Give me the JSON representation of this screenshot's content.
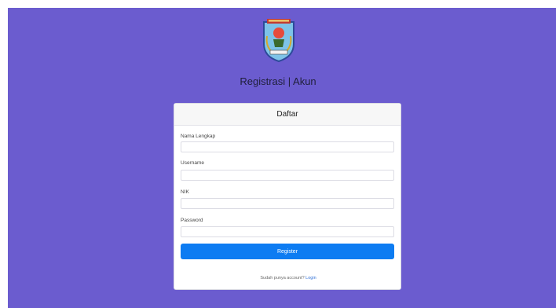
{
  "header": {
    "title": "Registrasi | Akun"
  },
  "logo": {
    "name": "regional-emblem"
  },
  "card": {
    "title": "Daftar"
  },
  "form": {
    "fields": [
      {
        "label": "Nama Lengkap",
        "value": "",
        "placeholder": ""
      },
      {
        "label": "Username",
        "value": "",
        "placeholder": ""
      },
      {
        "label": "NIK",
        "value": "",
        "placeholder": ""
      },
      {
        "label": "Password",
        "value": "",
        "placeholder": ""
      }
    ],
    "submit_label": "Register"
  },
  "footer": {
    "prompt": "Sudah punya account?",
    "link_label": "Login"
  },
  "colors": {
    "background": "#6b5ccf",
    "button": "#0d7cf2",
    "link": "#2f6fd6"
  }
}
